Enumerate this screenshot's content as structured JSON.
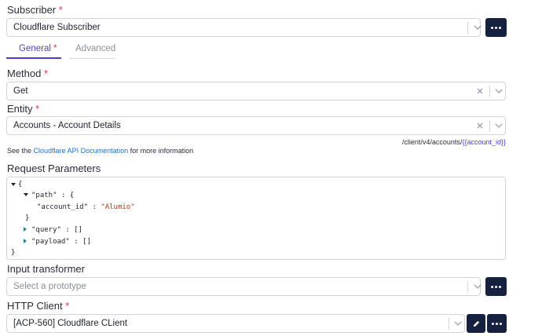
{
  "subscriber": {
    "label": "Subscriber",
    "required_mark": "*",
    "value": "Cloudflare Subscriber"
  },
  "tabs": [
    {
      "label": "General",
      "required_mark": "*",
      "active": true
    },
    {
      "label": "Advanced",
      "active": false
    }
  ],
  "method": {
    "label": "Method",
    "required_mark": "*",
    "value": "Get"
  },
  "entity": {
    "label": "Entity",
    "required_mark": "*",
    "value": "Accounts - Account Details",
    "path_prefix": "/client/v4/accounts/",
    "path_token": "{{account_id}}"
  },
  "docs": {
    "prefix": "See the ",
    "link_text": "Cloudflare API Documentation",
    "suffix": " for more information"
  },
  "request_parameters": {
    "label": "Request Parameters",
    "open_brace": "{",
    "close_brace": "}",
    "path_key": "\"path\"",
    "path_open": ": {",
    "account_id_key": "\"account_id\"",
    "colon": ":",
    "account_id_value": "\"Alumio\"",
    "path_close": "}",
    "query_key": "\"query\"",
    "query_value": ": []",
    "payload_key": "\"payload\"",
    "payload_value": ": []"
  },
  "input_transformer": {
    "label": "Input transformer",
    "placeholder": "Select a prototype"
  },
  "http_client": {
    "label": "HTTP Client",
    "required_mark": "*",
    "value": "[ACP-560] Cloudflare CLient"
  },
  "colors": {
    "accent": "#4b3fd6",
    "dark_button": "#16213f",
    "required": "#e0365a",
    "link": "#1a73c8",
    "string": "#b5361d"
  }
}
